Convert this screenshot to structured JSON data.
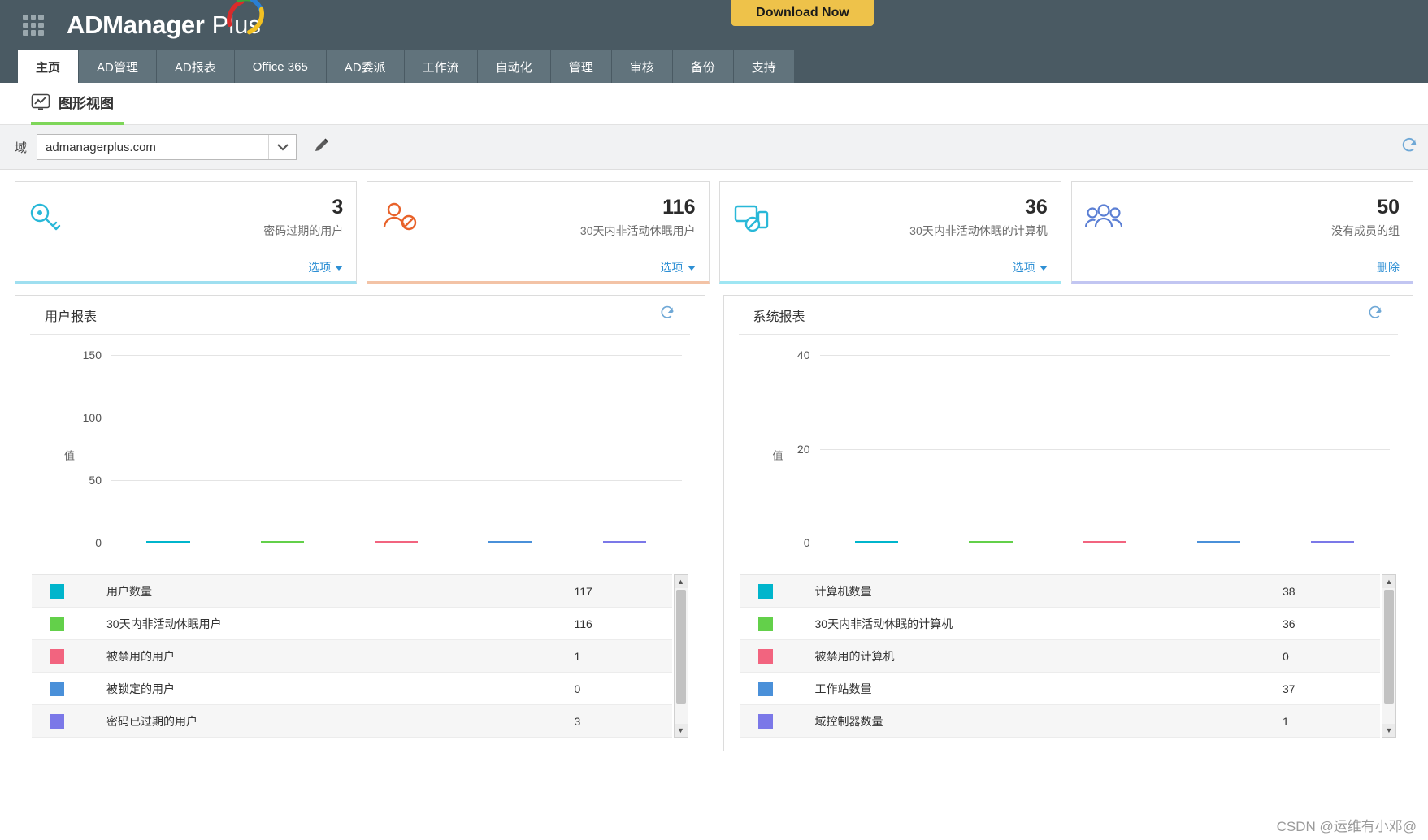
{
  "header": {
    "brand_ad": "ADManager",
    "brand_plus": "Plus",
    "download_label": "Download Now",
    "grid_icon": "apps-grid-icon",
    "logo_icon": "admanager-swoosh-logo"
  },
  "tabs": [
    {
      "label": "主页",
      "active": true
    },
    {
      "label": "AD管理",
      "active": false
    },
    {
      "label": "AD报表",
      "active": false
    },
    {
      "label": "Office 365",
      "active": false
    },
    {
      "label": "AD委派",
      "active": false
    },
    {
      "label": "工作流",
      "active": false
    },
    {
      "label": "自动化",
      "active": false
    },
    {
      "label": "管理",
      "active": false
    },
    {
      "label": "审核",
      "active": false
    },
    {
      "label": "备份",
      "active": false
    },
    {
      "label": "支持",
      "active": false
    }
  ],
  "subnav": {
    "icon": "chart-monitor-icon",
    "label": "图形视图"
  },
  "domain_bar": {
    "label": "域",
    "selected": "admanagerplus.com",
    "dropdown_icon": "chevron-down-icon",
    "edit_icon": "pencil-icon",
    "refresh_icon": "refresh-icon"
  },
  "cards": [
    {
      "value": "3",
      "caption": "密码过期的用户",
      "action": "选项",
      "action_has_caret": true,
      "icon": "key-icon",
      "icon_color": "#29b8d8",
      "accent": "#9fdff0"
    },
    {
      "value": "116",
      "caption": "30天内非活动休眠用户",
      "action": "选项",
      "action_has_caret": true,
      "icon": "user-disabled-icon",
      "icon_color": "#e8622a",
      "accent": "#f3c3a6"
    },
    {
      "value": "36",
      "caption": "30天内非活动休眠的计算机",
      "action": "选项",
      "action_has_caret": true,
      "icon": "computer-disabled-icon",
      "icon_color": "#29b8d8",
      "accent": "#9fe6f3"
    },
    {
      "value": "50",
      "caption": "没有成员的组",
      "action": "删除",
      "action_has_caret": false,
      "icon": "group-users-icon",
      "icon_color": "#5b7fd4",
      "accent": "#c2c6f2"
    }
  ],
  "panels": [
    {
      "title": "用户报表",
      "refresh_icon": "refresh-icon",
      "scroll_up_icon": "caret-up-icon",
      "scroll_down_icon": "caret-down-icon"
    },
    {
      "title": "系统报表",
      "refresh_icon": "refresh-icon",
      "scroll_up_icon": "caret-up-icon",
      "scroll_down_icon": "caret-down-icon"
    }
  ],
  "chart_data": [
    {
      "type": "bar",
      "title": "用户报表",
      "xlabel": "",
      "ylabel": "值",
      "ylim": [
        0,
        150
      ],
      "yticks": [
        0,
        50,
        100,
        150
      ],
      "grid": true,
      "legend": "table-below",
      "categories": [
        "用户数量",
        "30天内非活动休眠用户",
        "被禁用的用户",
        "被锁定的用户",
        "密码已过期的用户"
      ],
      "values": [
        117,
        116,
        1,
        0,
        3
      ],
      "colors": [
        "#00b5cc",
        "#63d04a",
        "#f2647f",
        "#4a90d9",
        "#7b78e8"
      ]
    },
    {
      "type": "bar",
      "title": "系统报表",
      "xlabel": "",
      "ylabel": "值",
      "ylim": [
        0,
        40
      ],
      "yticks": [
        0,
        20,
        40
      ],
      "grid": true,
      "legend": "table-below",
      "categories": [
        "计算机数量",
        "30天内非活动休眠的计算机",
        "被禁用的计算机",
        "工作站数量",
        "域控制器数量"
      ],
      "values": [
        38,
        36,
        0,
        37,
        1
      ],
      "colors": [
        "#00b5cc",
        "#63d04a",
        "#f2647f",
        "#4a90d9",
        "#7b78e8"
      ]
    }
  ],
  "legend_tables": [
    {
      "rows": [
        {
          "color": "#00b5cc",
          "name": "用户数量",
          "value": "117"
        },
        {
          "color": "#63d04a",
          "name": "30天内非活动休眠用户",
          "value": "116"
        },
        {
          "color": "#f2647f",
          "name": "被禁用的用户",
          "value": "1"
        },
        {
          "color": "#4a90d9",
          "name": "被锁定的用户",
          "value": "0"
        },
        {
          "color": "#7b78e8",
          "name": "密码已过期的用户",
          "value": "3"
        }
      ]
    },
    {
      "rows": [
        {
          "color": "#00b5cc",
          "name": "计算机数量",
          "value": "38"
        },
        {
          "color": "#63d04a",
          "name": "30天内非活动休眠的计算机",
          "value": "36"
        },
        {
          "color": "#f2647f",
          "name": "被禁用的计算机",
          "value": "0"
        },
        {
          "color": "#4a90d9",
          "name": "工作站数量",
          "value": "37"
        },
        {
          "color": "#7b78e8",
          "name": "域控制器数量",
          "value": "1"
        }
      ]
    }
  ],
  "watermark": "CSDN @运维有小邓@"
}
